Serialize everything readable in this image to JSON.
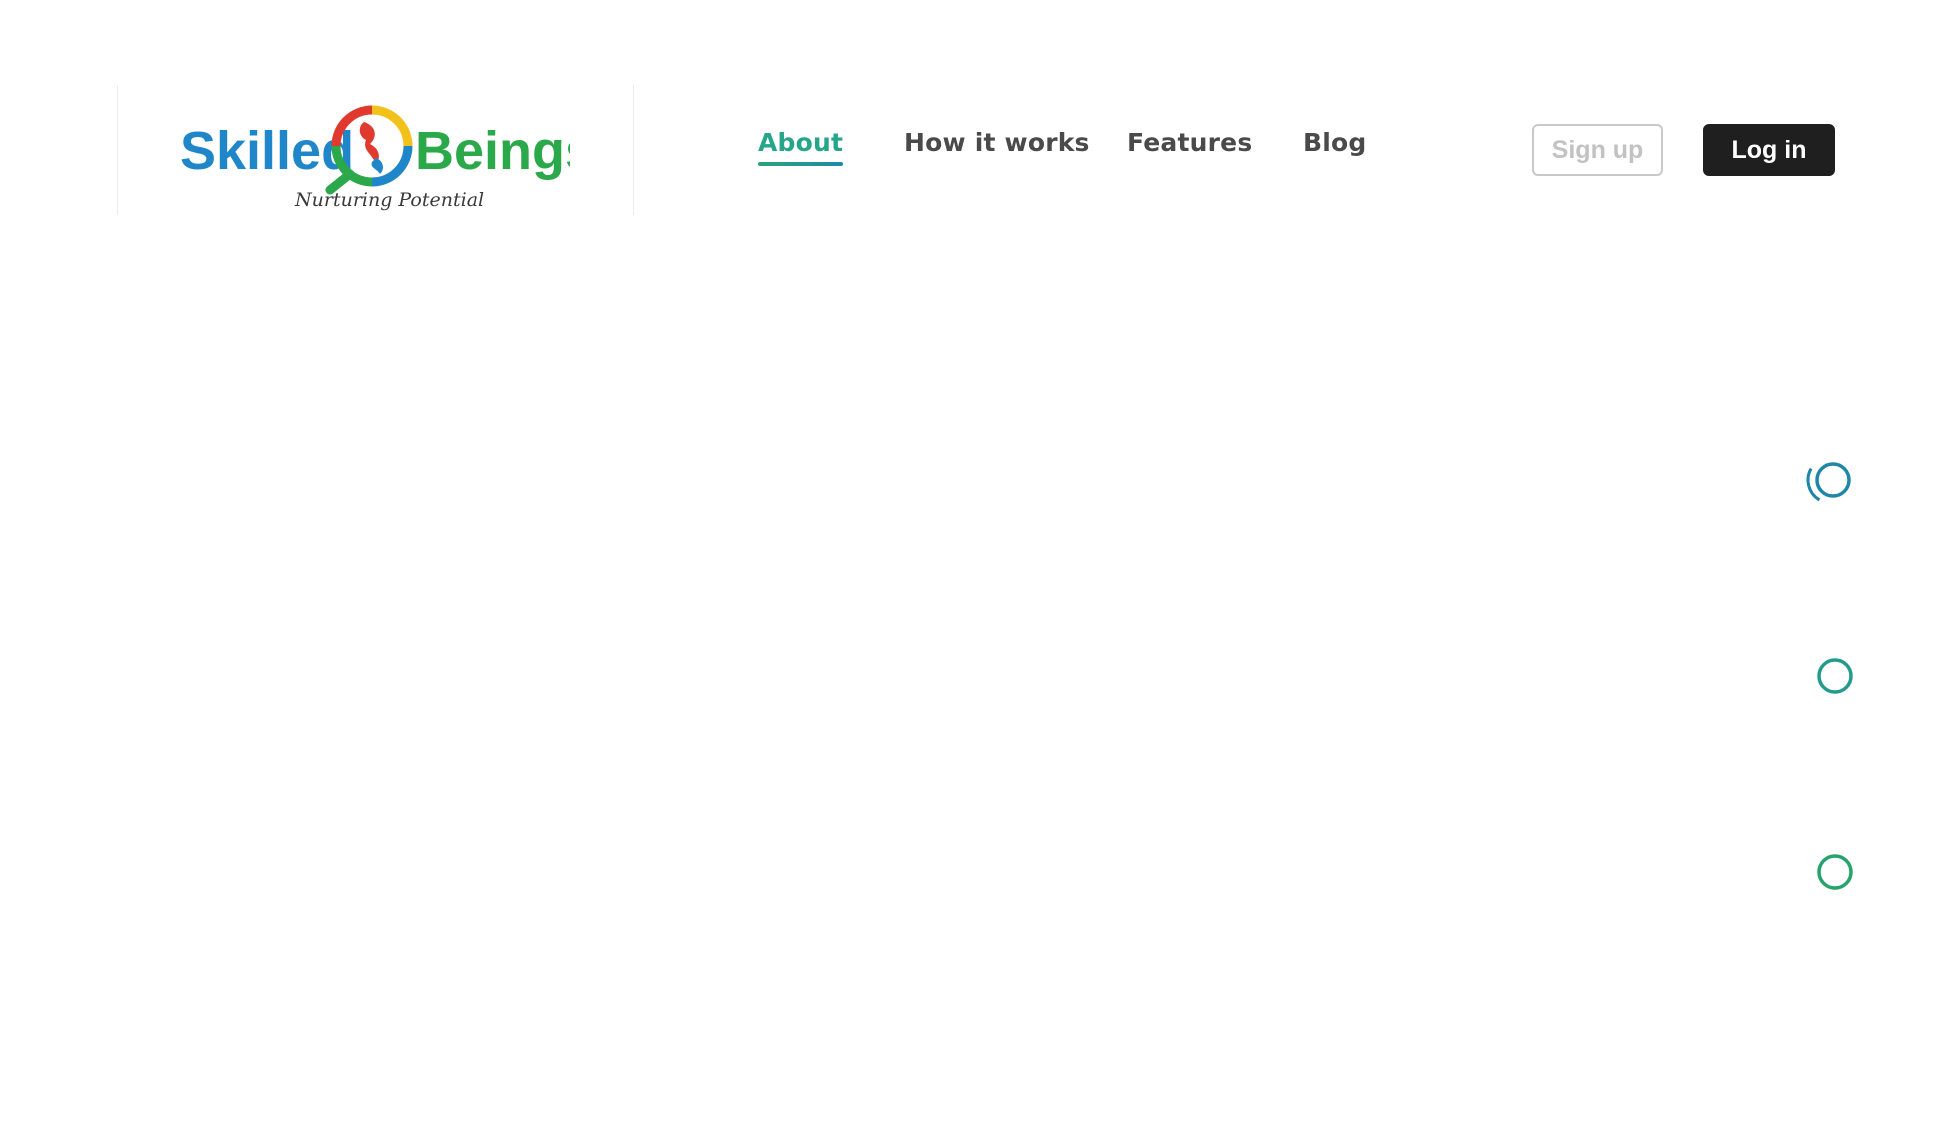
{
  "brand": {
    "name_part1": "Skilled",
    "name_part2": "Beings",
    "tagline": "Nurturing Potential",
    "colors": {
      "blue": "#1f86c9",
      "green": "#2aa84a",
      "red": "#e03a2f",
      "yellow": "#f3c21a"
    }
  },
  "nav": {
    "items": [
      {
        "label": "About",
        "active": true
      },
      {
        "label": "How it works",
        "active": false
      },
      {
        "label": "Features",
        "active": false
      },
      {
        "label": "Blog",
        "active": false
      }
    ]
  },
  "auth": {
    "signup_label": "Sign up",
    "login_label": "Log in"
  },
  "progress_stepper": {
    "steps": 3,
    "current_step": 1,
    "gradient": [
      "#1f86a8",
      "#2aa84a"
    ]
  }
}
